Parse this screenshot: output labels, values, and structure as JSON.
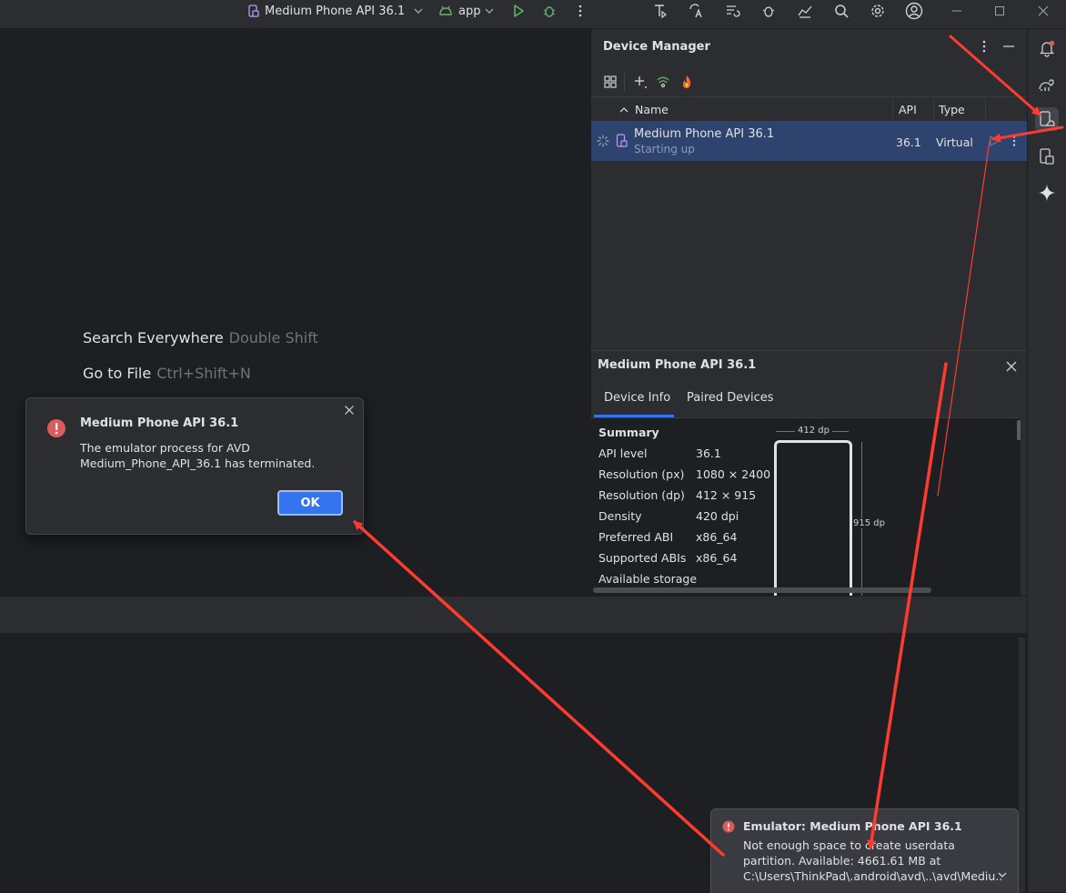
{
  "titlebar": {
    "device_selector": "Medium Phone API 36.1",
    "run_config": "app"
  },
  "editor": {
    "hints": [
      {
        "label": "Search Everywhere",
        "shortcut": "Double Shift"
      },
      {
        "label": "Go to File",
        "shortcut": "Ctrl+Shift+N"
      }
    ]
  },
  "device_manager": {
    "title": "Device Manager",
    "columns": {
      "name": "Name",
      "api": "API",
      "type": "Type"
    },
    "devices": [
      {
        "name": "Medium Phone API 36.1",
        "status": "Starting up",
        "api": "36.1",
        "type": "Virtual"
      }
    ]
  },
  "device_info": {
    "title": "Medium Phone API 36.1",
    "tabs": [
      "Device Info",
      "Paired Devices"
    ],
    "summary_label": "Summary",
    "properties": [
      {
        "name": "API level",
        "value": "36.1"
      },
      {
        "name": "Resolution (px)",
        "value": "1080 × 2400"
      },
      {
        "name": "Resolution (dp)",
        "value": "412 × 915"
      },
      {
        "name": "Density",
        "value": "420 dpi"
      },
      {
        "name": "Preferred ABI",
        "value": "x86_64"
      },
      {
        "name": "Supported ABIs",
        "value": "x86_64"
      },
      {
        "name": "Available storage",
        "value": ""
      }
    ],
    "width_label": "412 dp",
    "height_label": "915 dp"
  },
  "dialog": {
    "title": "Medium Phone API 36.1",
    "message_line1": "The emulator process for AVD",
    "message_line2": "Medium_Phone_API_36.1 has terminated.",
    "ok_label": "OK"
  },
  "notification": {
    "title": "Emulator: Medium Phone API 36.1",
    "line1": "Not enough space to create userdata",
    "line2": "partition. Available: 4661.61 MB at",
    "line3": "C:\\Users\\ThinkPad\\.android\\avd\\..\\avd\\Mediu..."
  },
  "colors": {
    "accent": "#3574f0",
    "error": "#db5c5c",
    "annotation_arrow": "#ff3b30",
    "selection": "#2e436e"
  }
}
